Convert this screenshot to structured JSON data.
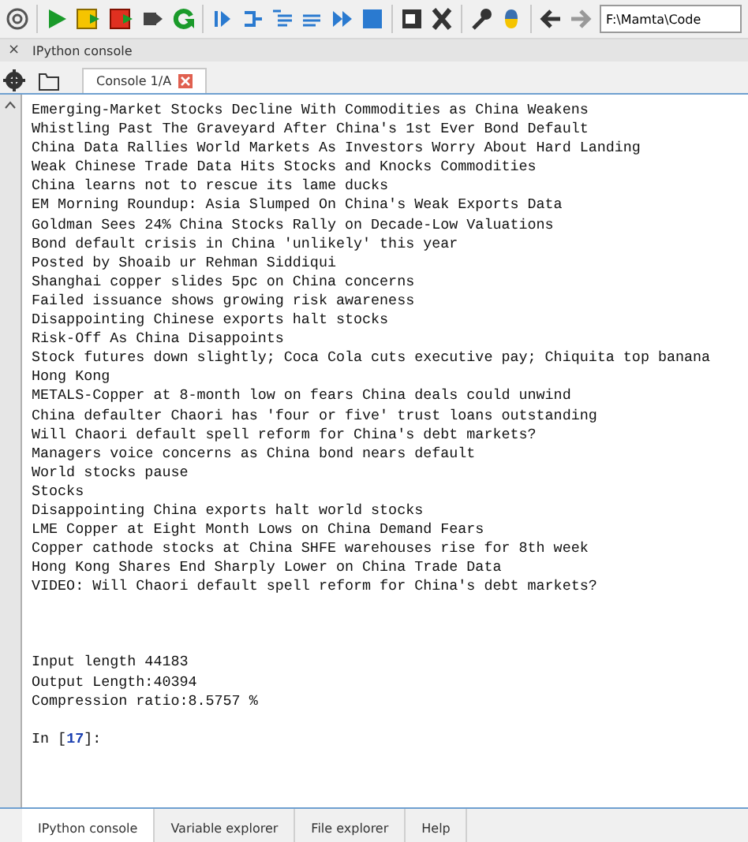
{
  "toolbar": {
    "path_field": {
      "value": "F:\\Mamta\\Code"
    }
  },
  "pane": {
    "close": "×",
    "title": "IPython console"
  },
  "console_tabs": [
    {
      "label": "Console 1/A",
      "selected": true
    }
  ],
  "output_lines": [
    "Emerging-Market Stocks Decline With Commodities as China Weakens",
    "Whistling Past The Graveyard After China's 1st Ever Bond Default",
    "China Data Rallies World Markets As Investors Worry About Hard Landing",
    "Weak Chinese Trade Data Hits Stocks and Knocks Commodities",
    "China learns not to rescue its lame ducks",
    "EM Morning Roundup: Asia Slumped On China's Weak Exports Data",
    "Goldman Sees 24% China Stocks Rally on Decade-Low Valuations",
    "Bond default crisis in China 'unlikely' this year",
    "Posted by Shoaib ur Rehman Siddiqui",
    "Shanghai copper slides 5pc on China concerns",
    "Failed issuance shows growing risk awareness",
    "Disappointing Chinese exports halt stocks",
    "Risk-Off As China Disappoints",
    "Stock futures down slightly; Coca Cola cuts executive pay; Chiquita top banana",
    "Hong Kong",
    "METALS-Copper at 8-month low on fears China deals could unwind",
    "China defaulter Chaori has 'four or five' trust loans outstanding",
    "Will Chaori default spell reform for China's debt markets?",
    "Managers voice concerns as China bond nears default",
    "World stocks pause",
    "Stocks",
    "Disappointing China exports halt world stocks",
    "LME Copper at Eight Month Lows on China Demand Fears",
    "Copper cathode stocks at China SHFE warehouses rise for 8th week",
    "Hong Kong Shares End Sharply Lower on China Trade Data",
    "VIDEO: Will Chaori default spell reform for China's debt markets?"
  ],
  "stats_lines": [
    "Input length 44183",
    "Output Length:40394",
    "Compression ratio:8.5757 %"
  ],
  "prompt": "In [**17**]:",
  "bottom_tabs": [
    {
      "label": "IPython console",
      "selected": true
    },
    {
      "label": "Variable explorer",
      "selected": false
    },
    {
      "label": "File explorer",
      "selected": false
    },
    {
      "label": "Help",
      "selected": false
    }
  ]
}
